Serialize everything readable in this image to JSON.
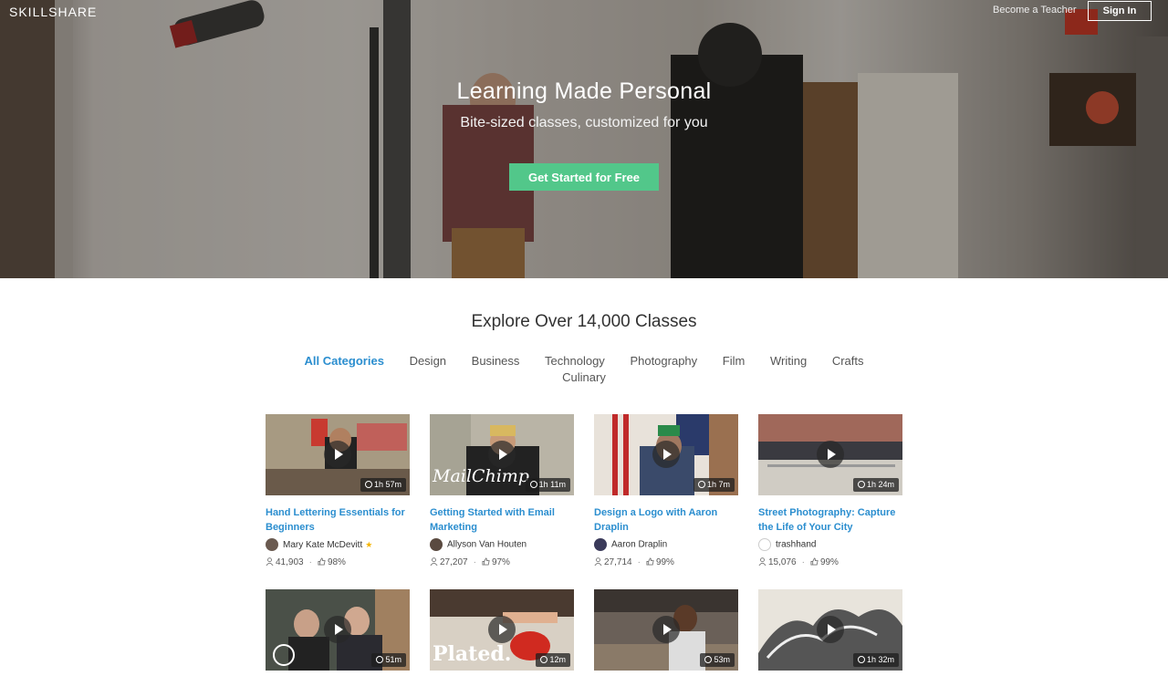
{
  "header": {
    "logo": "SKILLSHARE",
    "become_teacher": "Become a Teacher",
    "sign_in": "Sign In"
  },
  "hero": {
    "title": "Learning Made Personal",
    "subtitle": "Bite-sized classes, customized for you",
    "cta": "Get Started for Free"
  },
  "explore": {
    "title": "Explore Over 14,000 Classes",
    "categories": [
      "All Categories",
      "Design",
      "Business",
      "Technology",
      "Photography",
      "Film",
      "Writing",
      "Crafts",
      "Culinary"
    ],
    "active_category": "All Categories"
  },
  "classes": [
    {
      "title": "Hand Lettering Essentials for Beginners",
      "teacher": "Mary Kate McDevitt",
      "staff_pick": "★",
      "duration": "1h 57m",
      "students": "41,903",
      "rating": "98%",
      "thumb_color": "#9b8f7a"
    },
    {
      "title": "Getting Started with Email Marketing",
      "teacher": "Allyson Van Houten",
      "staff_pick": "",
      "duration": "1h 11m",
      "students": "27,207",
      "rating": "97%",
      "thumb_color": "#8a8478",
      "thumb_text": "MailChimp"
    },
    {
      "title": "Design a Logo with Aaron Draplin",
      "teacher": "Aaron Draplin",
      "staff_pick": "",
      "duration": "1h 7m",
      "students": "27,714",
      "rating": "99%",
      "thumb_color": "#7b5a4c"
    },
    {
      "title": "Street Photography: Capture the Life of Your City",
      "teacher": "trashhand",
      "staff_pick": "",
      "duration": "1h 24m",
      "students": "15,076",
      "rating": "99%",
      "thumb_color": "#6d7a82"
    },
    {
      "title": "",
      "teacher": "",
      "staff_pick": "",
      "duration": "51m",
      "students": "",
      "rating": "",
      "thumb_color": "#4a4c48"
    },
    {
      "title": "",
      "teacher": "",
      "staff_pick": "",
      "duration": "12m",
      "students": "",
      "rating": "",
      "thumb_color": "#b9a48c",
      "thumb_text": "Plated."
    },
    {
      "title": "",
      "teacher": "",
      "staff_pick": "",
      "duration": "53m",
      "students": "",
      "rating": "",
      "thumb_color": "#5f554c"
    },
    {
      "title": "",
      "teacher": "",
      "staff_pick": "",
      "duration": "1h 32m",
      "students": "",
      "rating": "",
      "thumb_color": "#d9d6d0"
    }
  ],
  "colors": {
    "accent": "#2b8ecf",
    "cta": "#52c78a"
  }
}
